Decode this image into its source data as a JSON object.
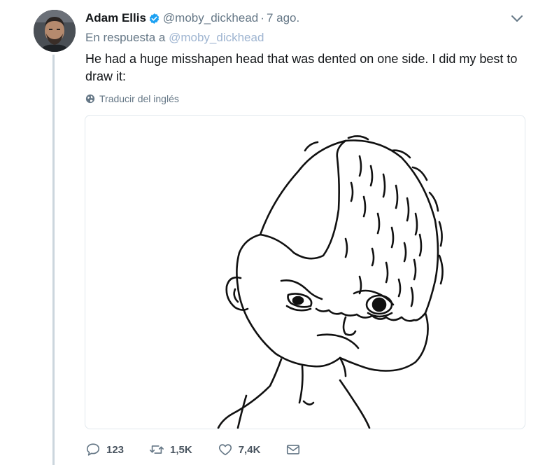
{
  "tweet": {
    "author_name": "Adam Ellis",
    "handle": "@moby_dickhead",
    "separator": "·",
    "time": "7 ago.",
    "reply_prefix": "En respuesta a",
    "reply_mention": "@moby_dickhead",
    "text": "He had a huge misshapen head that was dented on one side. I did my best to draw it:",
    "translate_label": "Traducir del inglés"
  },
  "actions": {
    "replies": "123",
    "retweets": "1,5K",
    "likes": "7,4K"
  },
  "icons": {
    "verified": "verified-badge-icon",
    "caret": "chevron-down-icon",
    "globe": "globe-icon",
    "reply": "reply-icon",
    "retweet": "retweet-icon",
    "like": "heart-icon",
    "message": "envelope-icon"
  },
  "colors": {
    "accent": "#1da1f2",
    "muted": "#657786",
    "border": "#e1e8ed"
  }
}
